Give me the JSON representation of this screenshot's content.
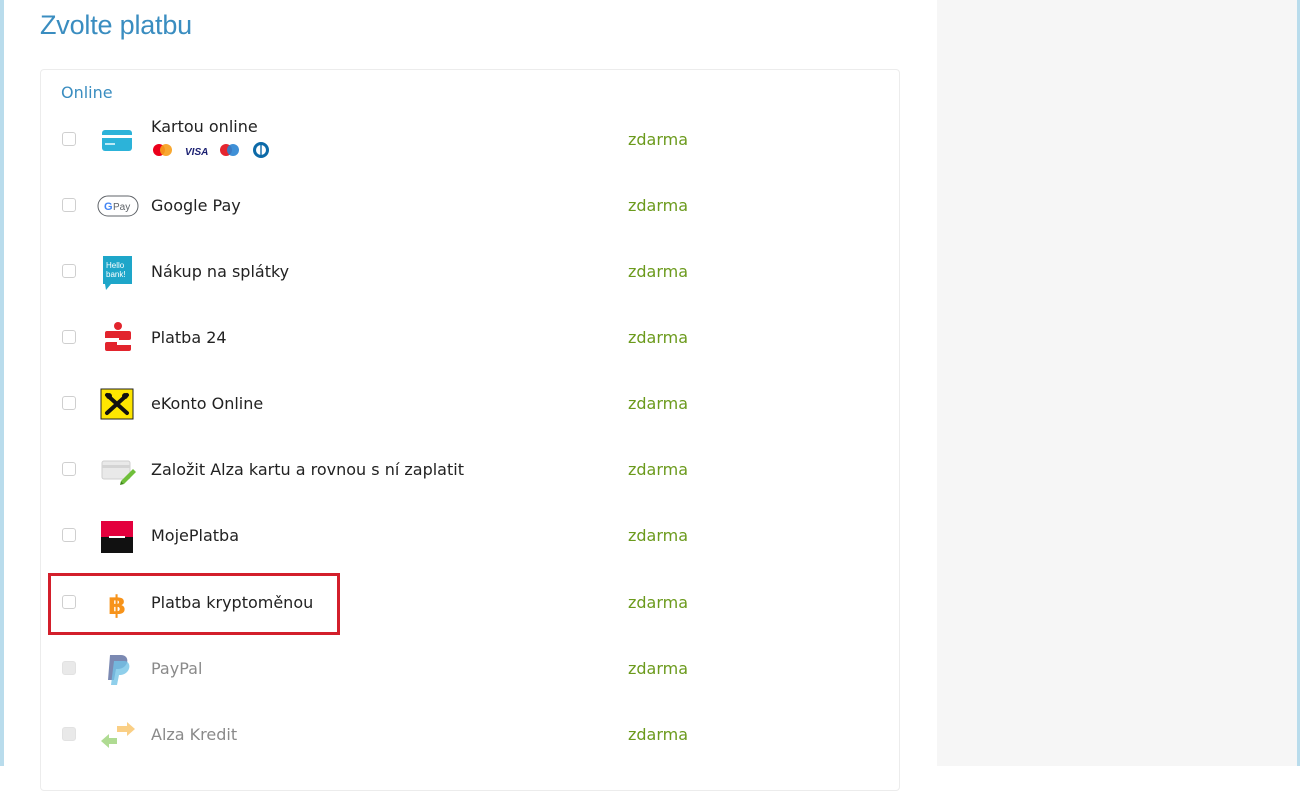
{
  "page": {
    "title": "Zvolte platbu"
  },
  "payments": {
    "section_label": "Online",
    "items": [
      {
        "name": "Kartou online",
        "price": "zdarma",
        "icon": "credit-card-icon",
        "enabled": true
      },
      {
        "name": "Google Pay",
        "price": "zdarma",
        "icon": "google-pay-icon",
        "enabled": true
      },
      {
        "name": "Nákup na splátky",
        "price": "zdarma",
        "icon": "hello-bank-icon",
        "enabled": true
      },
      {
        "name": "Platba 24",
        "price": "zdarma",
        "icon": "sporitelna-icon",
        "enabled": true
      },
      {
        "name": "eKonto Online",
        "price": "zdarma",
        "icon": "raiffeisen-icon",
        "enabled": true
      },
      {
        "name": "Založit Alza kartu a rovnou s ní zaplatit",
        "price": "zdarma",
        "icon": "alza-card-icon",
        "enabled": true
      },
      {
        "name": "MojePlatba",
        "price": "zdarma",
        "icon": "komercni-banka-icon",
        "enabled": true
      },
      {
        "name": "Platba kryptoměnou",
        "price": "zdarma",
        "icon": "bitcoin-icon",
        "enabled": true,
        "highlighted": true
      },
      {
        "name": "PayPal",
        "price": "zdarma",
        "icon": "paypal-icon",
        "enabled": false
      },
      {
        "name": "Alza Kredit",
        "price": "zdarma",
        "icon": "alza-kredit-icon",
        "enabled": false
      }
    ],
    "card_brands": [
      "mastercard-icon",
      "visa-icon",
      "maestro-icon",
      "diners-club-icon"
    ],
    "card_brand_visa_text": "VISA",
    "google_pay_text": "Pay",
    "hello_bank_text": [
      "Hello",
      "bank!"
    ]
  },
  "colors": {
    "title": "#3a8dc0",
    "price": "#6b9a1c",
    "highlight": "#d31f2b",
    "frame": "#b9dcec",
    "side_panel": "#f6f6f6"
  }
}
